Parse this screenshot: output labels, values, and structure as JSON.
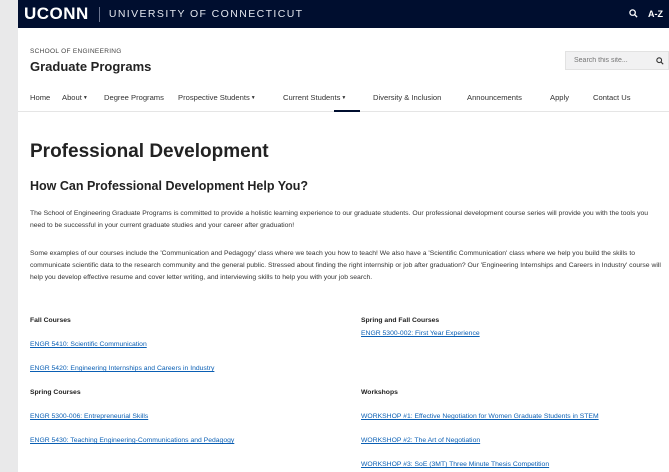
{
  "topbar": {
    "logo": "UCONN",
    "university": "UNIVERSITY OF CONNECTICUT",
    "az_label": "A-Z"
  },
  "header": {
    "school": "SCHOOL OF ENGINEERING",
    "title": "Graduate Programs",
    "search_placeholder": "Search this site..."
  },
  "nav": {
    "items": [
      {
        "label": "Home"
      },
      {
        "label": "About"
      },
      {
        "label": "Degree Programs"
      },
      {
        "label": "Prospective Students"
      },
      {
        "label": "Current Students"
      },
      {
        "label": "Diversity & Inclusion"
      },
      {
        "label": "Announcements"
      },
      {
        "label": "Apply"
      },
      {
        "label": "Contact Us"
      }
    ],
    "active": "Current Students"
  },
  "main": {
    "title": "Professional Development",
    "subtitle": "How Can Professional Development Help You?",
    "para1": "The School of Engineering Graduate Programs is committed to provide a holistic learning experience to our graduate students. Our professional development course series will provide you with the tools you need to be successful in your current graduate studies and your career after graduation!",
    "para2": "Some examples of our courses include the 'Communication and Pedagogy' class where we teach you how to teach! We also have a 'Scientific Communication' class where we help you build the skills to communicate scientific data to the research community and the general public. Stressed about finding the right internship or job after graduation? Our 'Engineering Internships and Careers in Industry' course will help you develop effective resume and cover letter writing, and interviewing skills to help you with your job search.",
    "fall": {
      "heading": "Fall Courses",
      "links": [
        "ENGR 5410: Scientific Communication",
        "ENGR 5420: Engineering Internships and Careers in Industry"
      ]
    },
    "spring_fall": {
      "heading": "Spring and Fall Courses",
      "links": [
        "ENGR 5300-002: First Year Experience"
      ]
    },
    "spring": {
      "heading": "Spring Courses",
      "links": [
        "ENGR 5300-006: Entrepreneurial Skills",
        "ENGR 5430: Teaching Engineering-Communications and Pedagogy"
      ]
    },
    "workshops": {
      "heading": "Workshops",
      "links": [
        "WORKSHOP #1: Effective Negotiation for Women Graduate Students in STEM",
        "WORKSHOP #2: The Art of Negotiation",
        "WORKSHOP #3: SoE (3MT) Three Minute Thesis Competition"
      ]
    }
  },
  "colors": {
    "navy": "#000e2f",
    "link": "#0a5fb4"
  }
}
